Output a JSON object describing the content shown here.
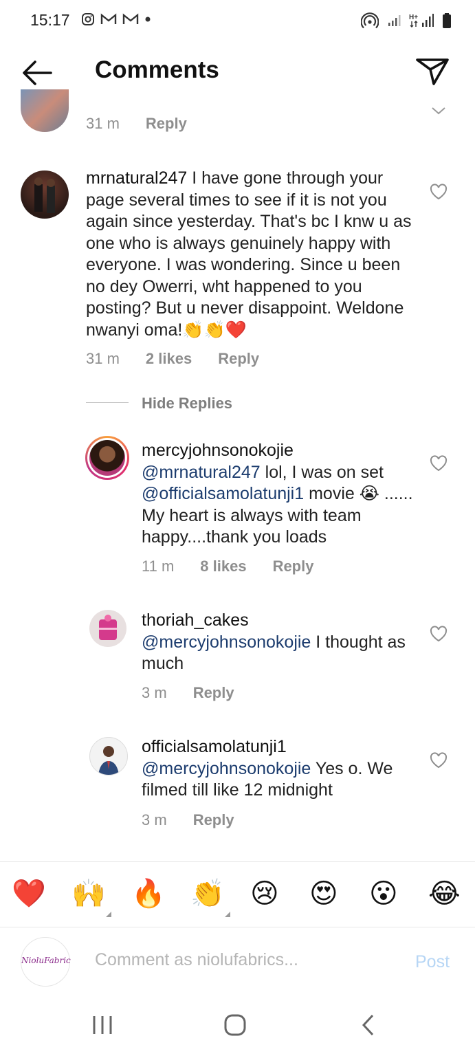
{
  "status_bar": {
    "time": "15:17"
  },
  "header": {
    "title": "Comments"
  },
  "partial_comment": {
    "time": "31 m",
    "reply": "Reply"
  },
  "comments": [
    {
      "username": "mrnatural247",
      "text": " I have gone through your page several times to see if it is not you again since yesterday. That's bc I knw u as one who is always genuinely happy with everyone. I was wondering. Since u been no dey Owerri, wht happened to you posting? But u never disappoint. Weldone nwanyi oma!👏👏❤️",
      "time": "31 m",
      "likes": "2 likes",
      "reply": "Reply"
    }
  ],
  "hide_replies": "Hide Replies",
  "replies": [
    {
      "username": "mercyjohnsonokojie",
      "mention1": "@mrnatural247",
      "text1": "  lol, I was on set ",
      "mention2": "@officialsamolatunji1",
      "text2": "  movie 😭 ...... My heart is always with team happy....thank you loads",
      "time": "11 m",
      "likes": "8 likes",
      "reply": "Reply"
    },
    {
      "username": "thoriah_cakes",
      "mention": "@mercyjohnsonokojie",
      "text": " I thought as much",
      "time": "3 m",
      "reply": "Reply"
    },
    {
      "username": "officialsamolatunji1",
      "mention": "@mercyjohnsonokojie",
      "text": " Yes o. We filmed till like 12 midnight",
      "time": "3 m",
      "reply": "Reply"
    }
  ],
  "emoji_bar": [
    "❤️",
    "🙌",
    "🔥",
    "👏",
    "😢",
    "😍",
    "😮",
    "😂"
  ],
  "compose": {
    "avatar_text": "NioluFabric",
    "placeholder": "Comment as niolufabrics...",
    "post": "Post"
  },
  "colors": {
    "mention": "#1c3c6e",
    "post_disabled": "#b7d6f5",
    "meta": "#8e8e8e"
  }
}
